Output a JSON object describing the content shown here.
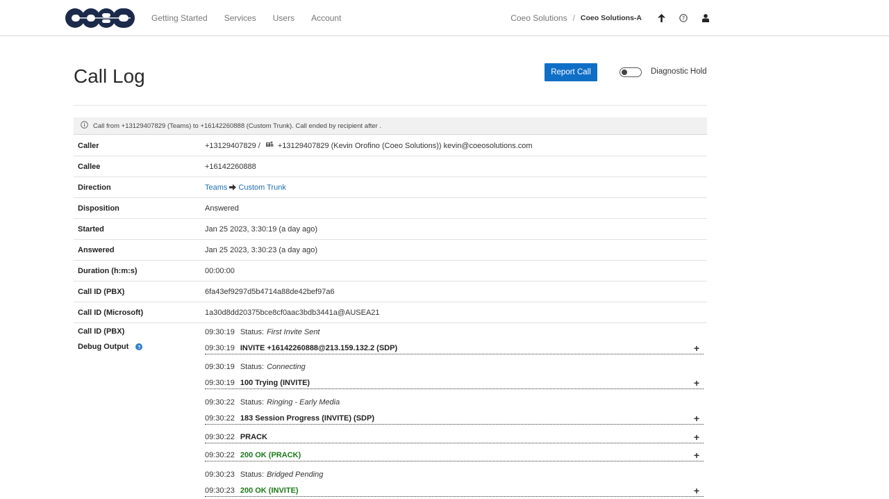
{
  "nav": {
    "logo_alt": "coeo",
    "links": [
      "Getting Started",
      "Services",
      "Users",
      "Account"
    ],
    "breadcrumb": {
      "parent": "Coeo Solutions",
      "separator": "/",
      "current": "Coeo Solutions-A"
    },
    "icons": [
      "arrow-up-icon",
      "help-circle-icon",
      "user-icon"
    ]
  },
  "page": {
    "title": "Call Log",
    "report_button": "Report Call",
    "diagnostic_hold": {
      "label": "Diagnostic Hold",
      "enabled": false
    }
  },
  "info": {
    "text": "Call from +13129407829 (Teams) to +16142260888 (Custom Trunk). Call ended by recipient after ."
  },
  "details": [
    {
      "label": "Caller",
      "value_prefix": "+13129407829 /",
      "value": "+13129407829 (Kevin Orofino (Coeo Solutions)) kevin@coeosolutions.com"
    },
    {
      "label": "Callee",
      "value": "+16142260888"
    },
    {
      "label": "Direction",
      "from": "Teams",
      "to": "Custom Trunk"
    },
    {
      "label": "Disposition",
      "value": "Answered"
    },
    {
      "label": "Started",
      "value": "Jan 25 2023, 3:30:19 (a day ago)"
    },
    {
      "label": "Answered",
      "value": "Jan 25 2023, 3:30:23 (a day ago)"
    },
    {
      "label": "Duration (h:m:s)",
      "value": "00:00:00"
    },
    {
      "label": "Call ID (PBX)",
      "value": "6fa43ef9297d5b4714a88de42bef97a6"
    },
    {
      "label": "Call ID (Microsoft)",
      "value": "1a30d8dd20375bce8cf0aac3bdb3441a@AUSEA21"
    }
  ],
  "debug": {
    "label_call_id": "Call ID (PBX)",
    "label_output": "Debug Output",
    "status_prefix": "Status:",
    "events": [
      {
        "time": "09:30:19",
        "type": "status",
        "text": "First Invite Sent"
      },
      {
        "time": "09:30:19",
        "type": "message",
        "text": "INVITE +16142260888@213.159.132.2 (SDP)"
      },
      {
        "time": "09:30:19",
        "type": "status",
        "text": "Connecting"
      },
      {
        "time": "09:30:19",
        "type": "message",
        "text": "100 Trying (INVITE)"
      },
      {
        "time": "09:30:22",
        "type": "status",
        "text": "Ringing - Early Media"
      },
      {
        "time": "09:30:22",
        "type": "message",
        "text": "183 Session Progress (INVITE) (SDP)"
      },
      {
        "time": "09:30:22",
        "type": "message",
        "text": "PRACK"
      },
      {
        "time": "09:30:22",
        "type": "message",
        "text": "200 OK (PRACK)",
        "ok": true
      },
      {
        "time": "09:30:23",
        "type": "status",
        "text": "Bridged Pending"
      },
      {
        "time": "09:30:23",
        "type": "message",
        "text": "200 OK (INVITE)",
        "ok": true
      }
    ]
  },
  "colors": {
    "brand": "#1b2a4a",
    "accent": "#0f6fc6",
    "link": "#1f6fb5",
    "ok": "#1a7a1a"
  }
}
